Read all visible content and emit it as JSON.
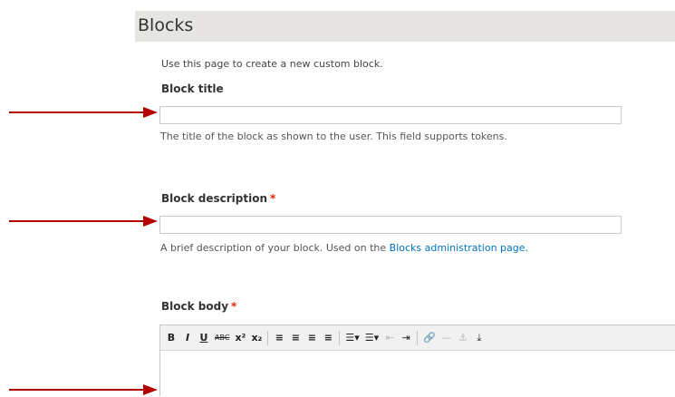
{
  "page": {
    "title": "Blocks"
  },
  "intro": "Use this page to create a new custom block.",
  "fields": {
    "block_title": {
      "label": "Block title",
      "value": "",
      "help": "The title of the block as shown to the user. This field supports tokens."
    },
    "block_description": {
      "label": "Block description",
      "required_marker": "*",
      "value": "",
      "help_prefix": "A brief description of your block. Used on the ",
      "help_link": "Blocks administration page."
    },
    "block_body": {
      "label": "Block body",
      "required_marker": "*"
    }
  },
  "toolbar": {
    "bold": "B",
    "italic": "I",
    "underline": "U",
    "strikethrough": "ABC",
    "superscript": "x²",
    "subscript": "x₂",
    "align_left": "≡",
    "align_center": "≡",
    "align_right": "≡",
    "align_justify": "≡",
    "bulleted_list": "☰▾",
    "numbered_list": "☰▾",
    "outdent": "⇤",
    "indent": "⇥",
    "link": "🔗",
    "unlink": "—",
    "anchor": "⚓",
    "image": "⤓"
  },
  "colors": {
    "accent_link": "#0074bd",
    "required": "#e62600",
    "arrow": "#b30000"
  }
}
